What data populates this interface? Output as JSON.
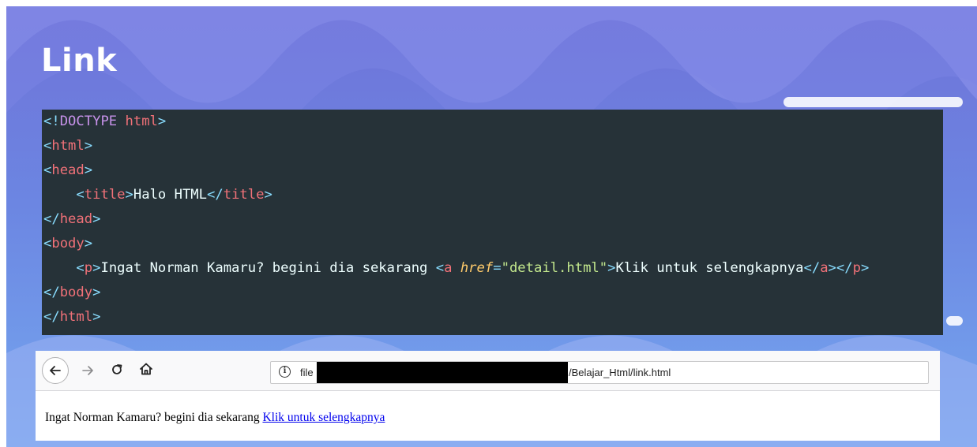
{
  "slide": {
    "title": "Link",
    "background_color": "#6f72d8",
    "wave_color": "#8f96ec"
  },
  "code": {
    "background": "#263238",
    "colors": {
      "tag": "#f07178",
      "punctuation": "#89ddff",
      "doctype": "#c792ea",
      "attribute": "#ffcb6b",
      "string": "#c3e88d",
      "text": "#eeffff"
    },
    "l1_open": "<!",
    "l1_keyword": "DOCTYPE",
    "l1_name": "html",
    "l1_close": ">",
    "l2_name": "html",
    "l3_name": "head",
    "l4_indent": "    ",
    "l4_name": "title",
    "l4_text": "Halo HTML",
    "l4_close_name": "title",
    "l5_name": "head",
    "l6_name": "body",
    "l7_indent": "    ",
    "l7_p": "p",
    "l7_text": "Ingat Norman Kamaru? begini dia sekarang ",
    "l7_a": "a",
    "l7_attr": "href",
    "l7_eq": "=",
    "l7_value": "\"detail.html\"",
    "l7_link_text": "Klik untuk selengkapnya",
    "l7_close_a": "a",
    "l7_close_p": "p",
    "l8_name": "body",
    "l9_name": "html",
    "lt": "<",
    "gt": ">",
    "lt_slash": "</"
  },
  "browser": {
    "back_icon": "back-arrow-icon",
    "forward_icon": "forward-arrow-icon",
    "reload_icon": "reload-icon",
    "home_icon": "home-icon",
    "info_icon": "info-icon",
    "url_prefix": "file",
    "url_suffix": "/Belajar_Html/link.html",
    "page_text": "Ingat Norman Kamaru? begini dia sekarang ",
    "link_text": "Klik untuk selengkapnya",
    "link_color": "#0000ee"
  }
}
